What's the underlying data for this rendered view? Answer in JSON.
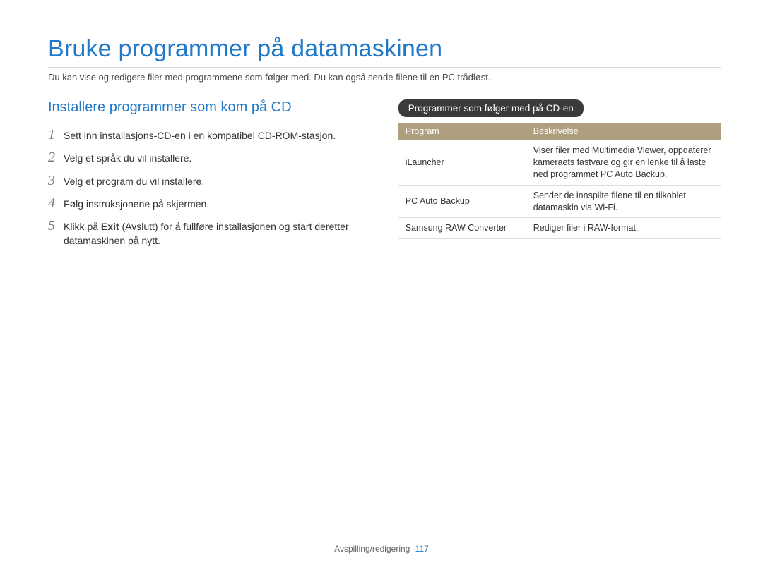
{
  "title": "Bruke programmer på datamaskinen",
  "intro": "Du kan vise og redigere filer med programmene som følger med. Du kan også sende filene til en PC trådløst.",
  "left": {
    "subheading": "Installere programmer som kom på CD",
    "steps": [
      {
        "n": "1",
        "text": "Sett inn installasjons-CD-en i en kompatibel CD-ROM-stasjon."
      },
      {
        "n": "2",
        "text": "Velg et språk du vil installere."
      },
      {
        "n": "3",
        "text": "Velg et program du vil installere."
      },
      {
        "n": "4",
        "text": "Følg instruksjonene på skjermen."
      },
      {
        "n": "5",
        "pre": "Klikk på ",
        "bold": "Exit",
        "post": " (Avslutt) for å fullføre installasjonen og start deretter datamaskinen på nytt."
      }
    ]
  },
  "right": {
    "pill": "Programmer som følger med på CD-en",
    "table": {
      "headers": [
        "Program",
        "Beskrivelse"
      ],
      "rows": [
        [
          "iLauncher",
          "Viser filer med Multimedia Viewer, oppdaterer kameraets fastvare og gir en lenke til å laste ned programmet PC Auto Backup."
        ],
        [
          "PC Auto Backup",
          "Sender de innspilte filene til en tilkoblet datamaskin via Wi-Fi."
        ],
        [
          "Samsung RAW Converter",
          "Rediger filer i RAW-format."
        ]
      ]
    }
  },
  "footer": {
    "section": "Avspilling/redigering",
    "page": "117"
  }
}
